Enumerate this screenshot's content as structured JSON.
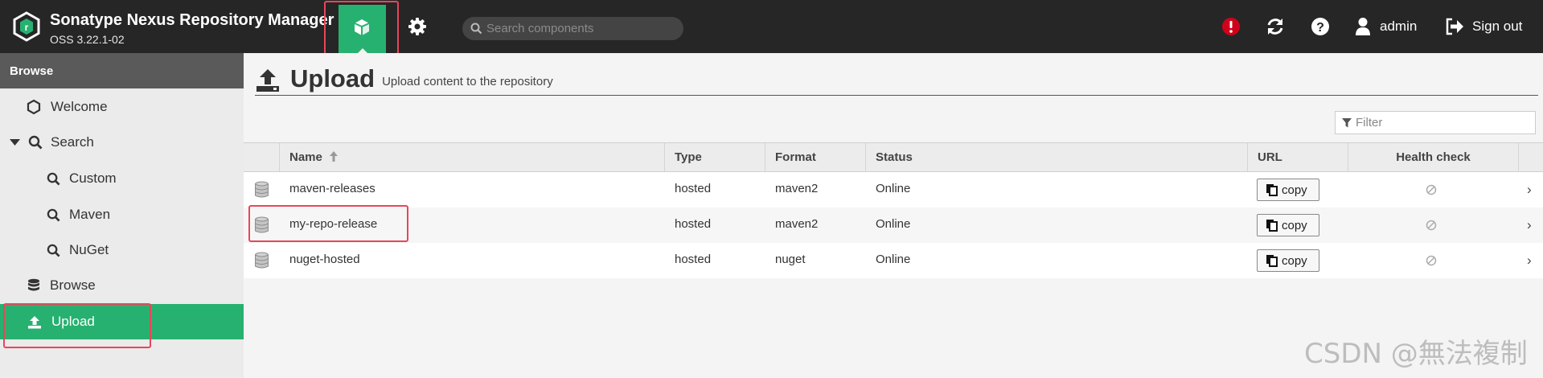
{
  "header": {
    "title": "Sonatype Nexus Repository Manager",
    "version": "OSS 3.22.1-02",
    "search_placeholder": "Search components",
    "user": "admin",
    "signout": "Sign out"
  },
  "sidebar": {
    "header": "Browse",
    "items": [
      {
        "label": "Welcome"
      },
      {
        "label": "Search"
      },
      {
        "label": "Custom"
      },
      {
        "label": "Maven"
      },
      {
        "label": "NuGet"
      },
      {
        "label": "Browse"
      },
      {
        "label": "Upload"
      }
    ]
  },
  "main": {
    "title": "Upload",
    "subtitle": "Upload content to the repository",
    "filter_placeholder": "Filter",
    "columns": [
      "Name",
      "Type",
      "Format",
      "Status",
      "URL",
      "Health check"
    ],
    "copy_label": "copy",
    "rows": [
      {
        "name": "maven-releases",
        "type": "hosted",
        "format": "maven2",
        "status": "Online"
      },
      {
        "name": "my-repo-release",
        "type": "hosted",
        "format": "maven2",
        "status": "Online"
      },
      {
        "name": "nuget-hosted",
        "type": "hosted",
        "format": "nuget",
        "status": "Online"
      }
    ]
  },
  "watermark": "CSDN @無法複制",
  "colors": {
    "accent": "#27b170",
    "header_bg": "#262626",
    "alert": "#d0021b",
    "annotation": "#e8465a"
  },
  "icons": [
    "logo-icon",
    "cube-icon",
    "gear-icon",
    "search-icon",
    "alert-icon",
    "refresh-icon",
    "help-icon",
    "user-icon",
    "sign-out-icon",
    "hexagon-icon",
    "database-icon",
    "upload-icon",
    "filter-icon",
    "copy-icon",
    "disabled-icon",
    "chevron-right-icon",
    "sort-up-icon"
  ]
}
